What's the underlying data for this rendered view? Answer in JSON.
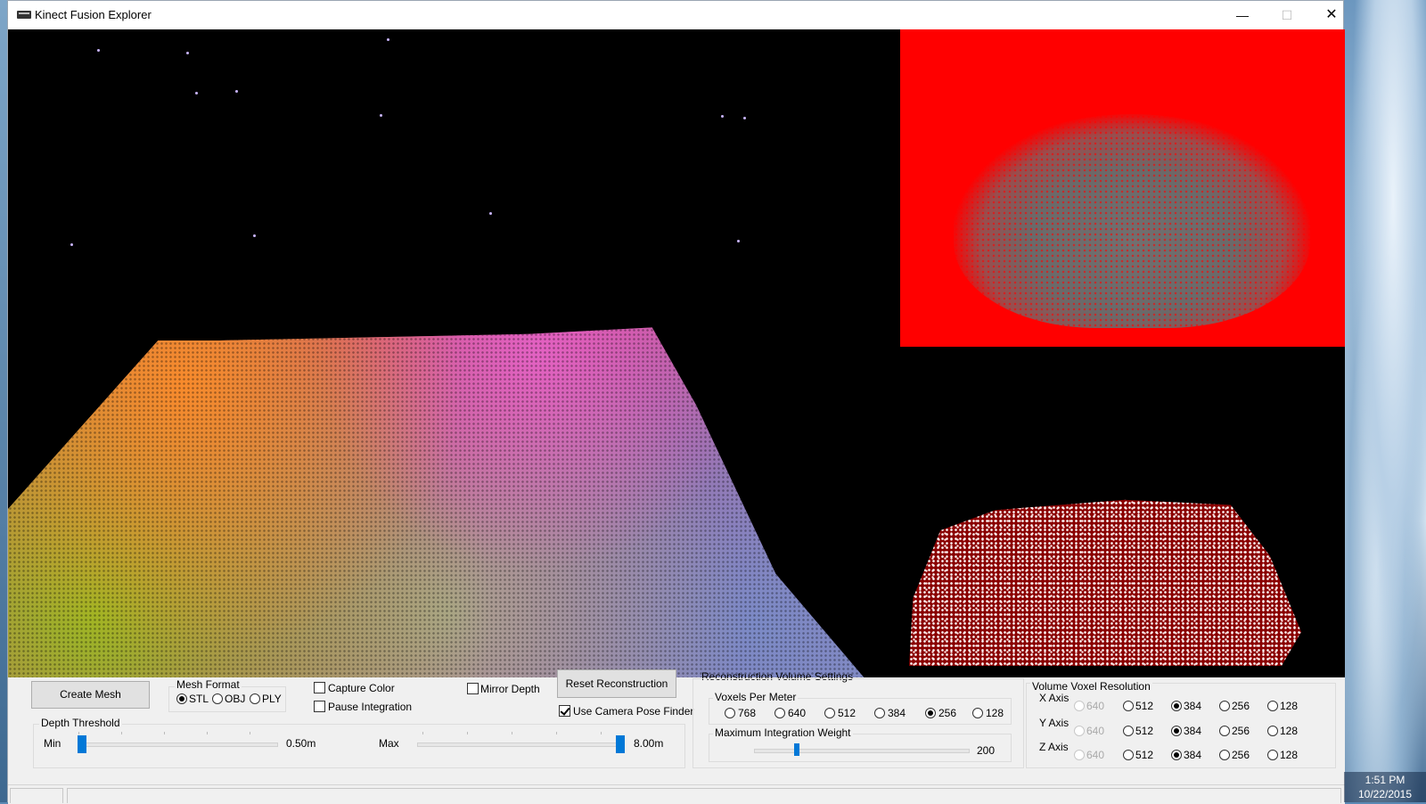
{
  "window": {
    "title": "Kinect Fusion Explorer",
    "minimize_glyph": "—",
    "maximize_glyph": "☐",
    "close_glyph": "✕"
  },
  "controls": {
    "create_mesh_label": "Create Mesh",
    "mesh_format": {
      "title": "Mesh Format",
      "options": [
        "STL",
        "OBJ",
        "PLY"
      ],
      "selected": "STL"
    },
    "capture_color": {
      "label": "Capture Color",
      "checked": false
    },
    "pause_integration": {
      "label": "Pause Integration",
      "checked": false
    },
    "mirror_depth": {
      "label": "Mirror Depth",
      "checked": false
    },
    "reset_label": "Reset Reconstruction",
    "use_camera_pose_finder": {
      "label": "Use Camera Pose Finder",
      "checked": true
    },
    "depth_threshold": {
      "title": "Depth Threshold",
      "min_label": "Min",
      "min_value": "0.50m",
      "max_label": "Max",
      "max_value": "8.00m"
    },
    "recon_volume": {
      "title": "Reconstruction Volume Settings",
      "voxels_per_meter_title": "Voxels Per Meter",
      "voxels_per_meter_options": [
        "768",
        "640",
        "512",
        "384",
        "256",
        "128"
      ],
      "voxels_per_meter_selected": "256",
      "max_weight_title": "Maximum Integration Weight",
      "max_weight_value": "200"
    },
    "voxel_resolution": {
      "title": "Volume Voxel Resolution",
      "axes": [
        {
          "label": "X Axis",
          "options": [
            "640",
            "512",
            "384",
            "256",
            "128"
          ],
          "selected": "384"
        },
        {
          "label": "Y Axis",
          "options": [
            "640",
            "512",
            "384",
            "256",
            "128"
          ],
          "selected": "384"
        },
        {
          "label": "Z Axis",
          "options": [
            "640",
            "512",
            "384",
            "256",
            "128"
          ],
          "selected": "384"
        }
      ]
    }
  },
  "taskbar": {
    "time": "1:51 PM",
    "date": "10/22/2015"
  },
  "colors": {
    "depth_background": "#ff0000",
    "slider_thumb": "#0078d7",
    "viewport_background": "#000000"
  }
}
